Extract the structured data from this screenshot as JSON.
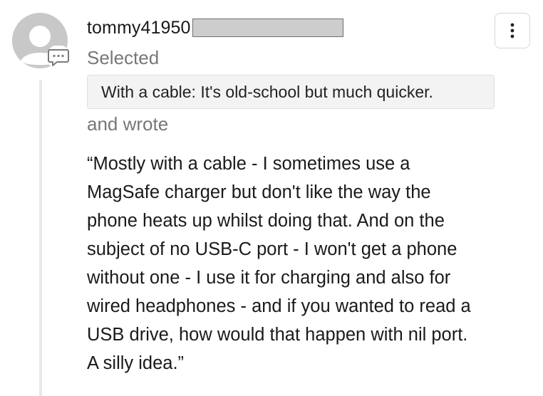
{
  "comment": {
    "username": "tommy41950",
    "selected_label": "Selected",
    "selected_option": "With a cable: It's old-school but much quicker.",
    "wrote_label": "and wrote",
    "quote": "“Mostly with a cable - I sometimes use a\nMagSafe charger but don't like the way the\nphone heats up whilst doing that. And on the\nsubject of no USB-C port - I won't get a phone\nwithout one - I use it for charging and also for\nwired headphones - and if you wanted to read a\nUSB drive, how would that happen with nil port.\nA silly idea.”"
  },
  "icons": {
    "avatar": "default-avatar-icon",
    "badge": "comment-bubble-icon",
    "menu": "more-vertical-icon"
  },
  "colors": {
    "text": "#1a1a1a",
    "muted": "#777777",
    "chip_bg": "#f3f3f3",
    "avatar_gray": "#c8c8c8",
    "thread_line": "#e9e9e9"
  }
}
